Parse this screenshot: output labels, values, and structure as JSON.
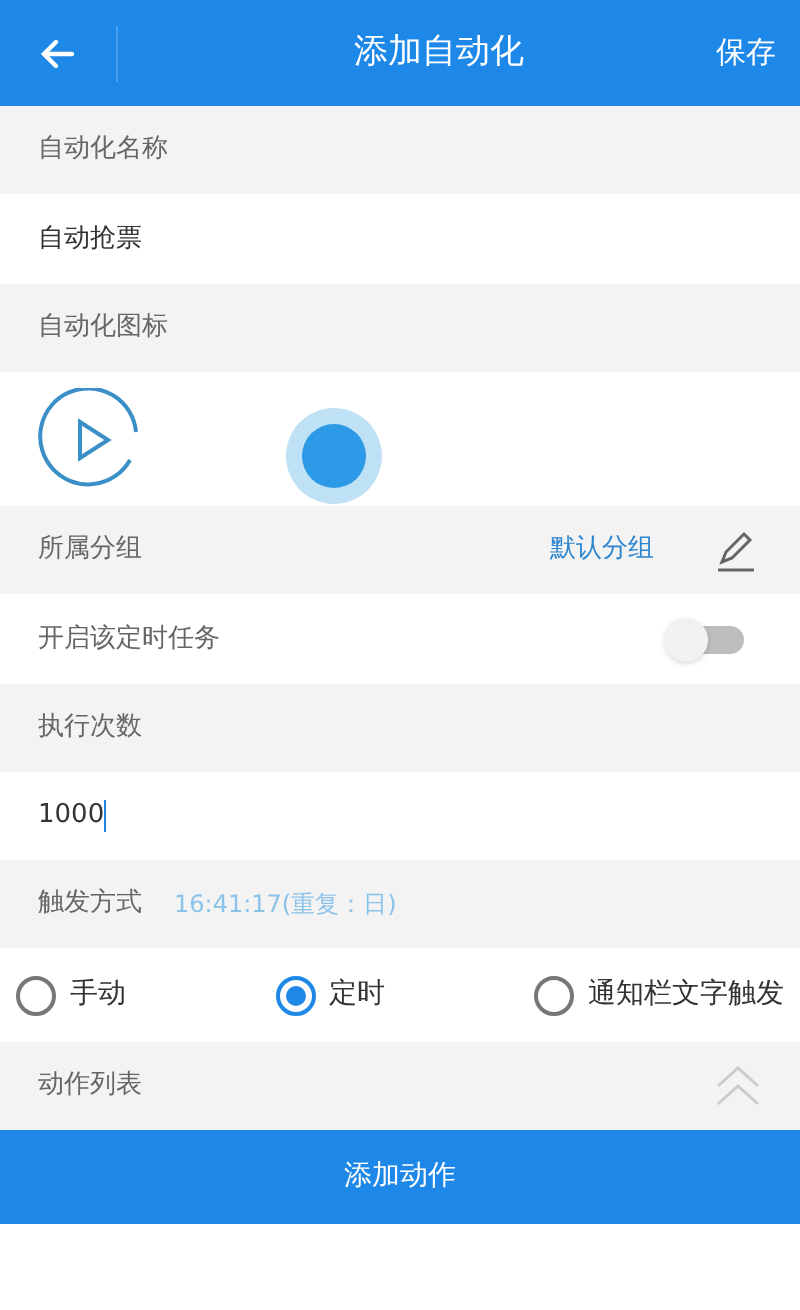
{
  "header": {
    "title": "添加自动化",
    "action": "保存"
  },
  "name_section": {
    "label": "自动化名称",
    "value": "自动抢票"
  },
  "icon_section": {
    "label": "自动化图标"
  },
  "group": {
    "label": "所属分组",
    "value": "默认分组"
  },
  "schedule_toggle": {
    "label": "开启该定时任务",
    "on": false
  },
  "count": {
    "label": "执行次数",
    "value": "1000"
  },
  "trigger": {
    "label": "触发方式",
    "detail": "16:41:17(重复：日)"
  },
  "trigger_options": [
    {
      "label": "手动",
      "selected": false
    },
    {
      "label": "定时",
      "selected": true
    },
    {
      "label": "通知栏文字触发",
      "selected": false
    }
  ],
  "action_list": {
    "label": "动作列表",
    "expanded": true
  },
  "add_button": {
    "label": "添加动作"
  }
}
